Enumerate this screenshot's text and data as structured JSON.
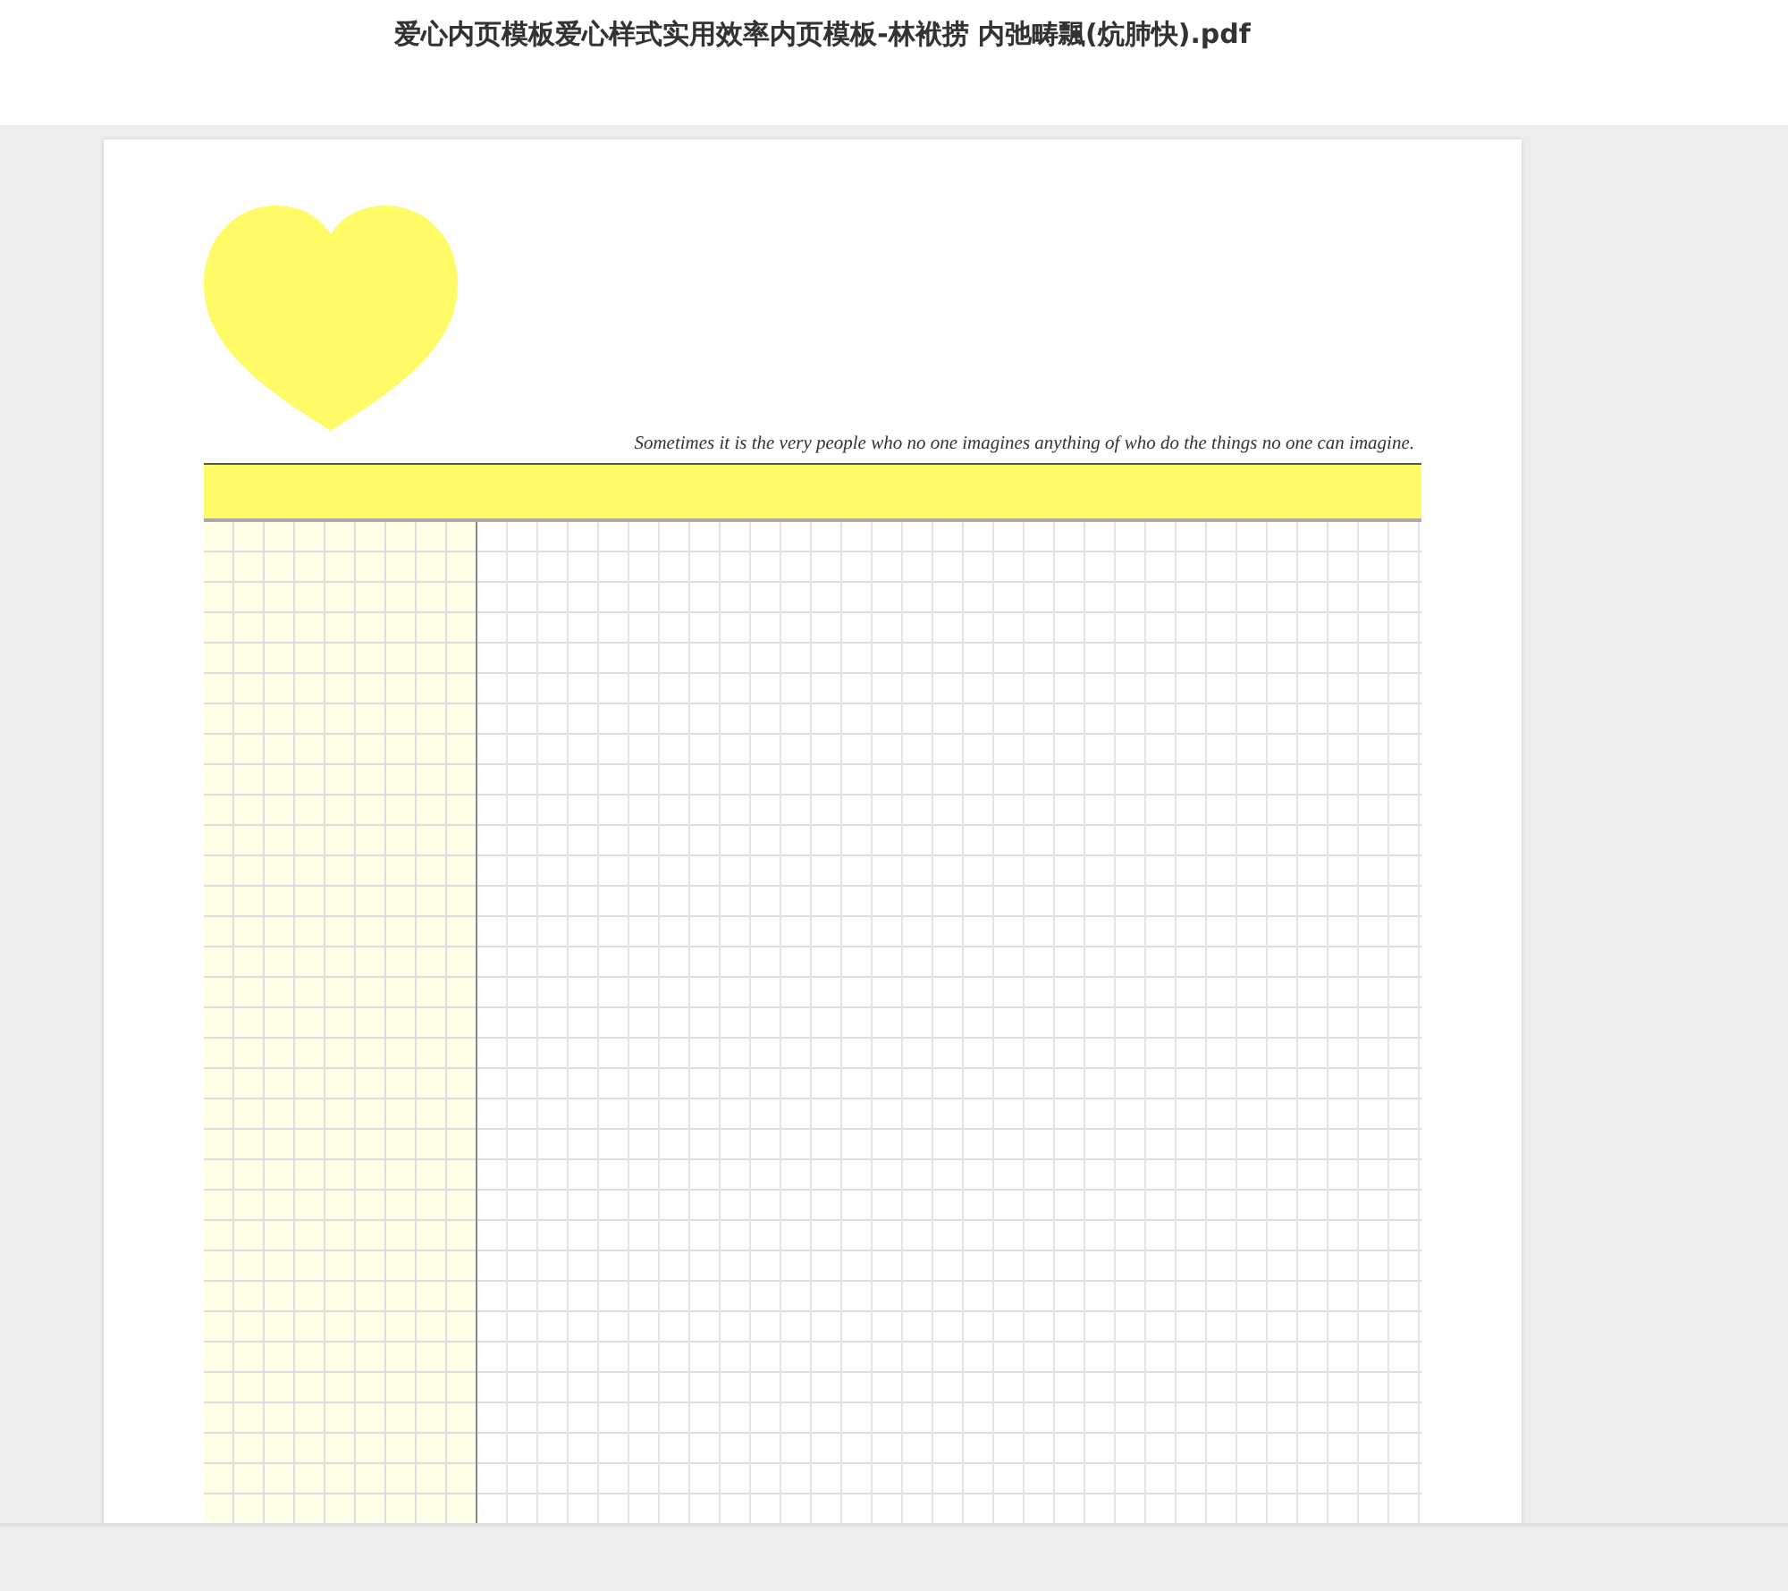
{
  "window": {
    "title": "爱心内页模板爱心样式实用效率内页模板-林袱捞 内弛畴飄(炕肺快).pdf"
  },
  "page": {
    "quote": "Sometimes it is the very people who no one imagines anything of who do the things no one can imagine."
  }
}
